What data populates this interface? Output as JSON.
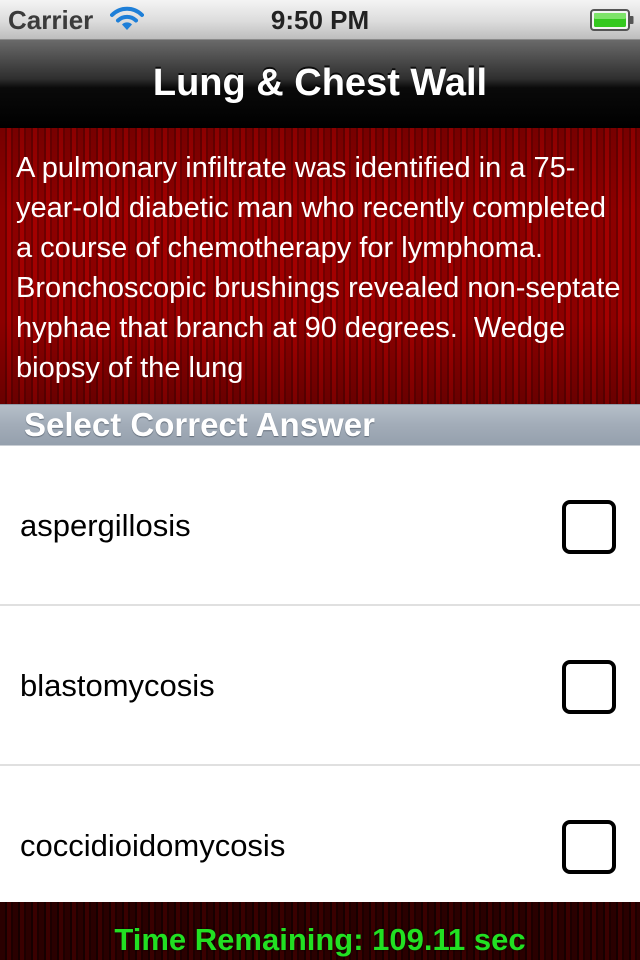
{
  "status_bar": {
    "carrier": "Carrier",
    "time": "9:50 PM",
    "wifi_icon": "wifi-icon",
    "battery_icon": "battery-icon"
  },
  "nav": {
    "title": "Lung & Chest Wall"
  },
  "question": {
    "text": "A pulmonary infiltrate was identified in a 75-year-old diabetic man who recently completed a course of chemotherapy for lymphoma.  Bronchoscopic brushings revealed non-septate hyphae that branch at 90 degrees.  Wedge biopsy of the lung"
  },
  "section": {
    "title": "Select Correct Answer"
  },
  "answers": [
    {
      "label": "aspergillosis",
      "checked": false
    },
    {
      "label": "blastomycosis",
      "checked": false
    },
    {
      "label": "coccidioidomycosis",
      "checked": false
    }
  ],
  "timer": {
    "text": "Time Remaining: 109.11 sec"
  },
  "colors": {
    "panel_red": "#8c0000",
    "timer_green": "#22e022",
    "section_header": "#a2acb8"
  }
}
